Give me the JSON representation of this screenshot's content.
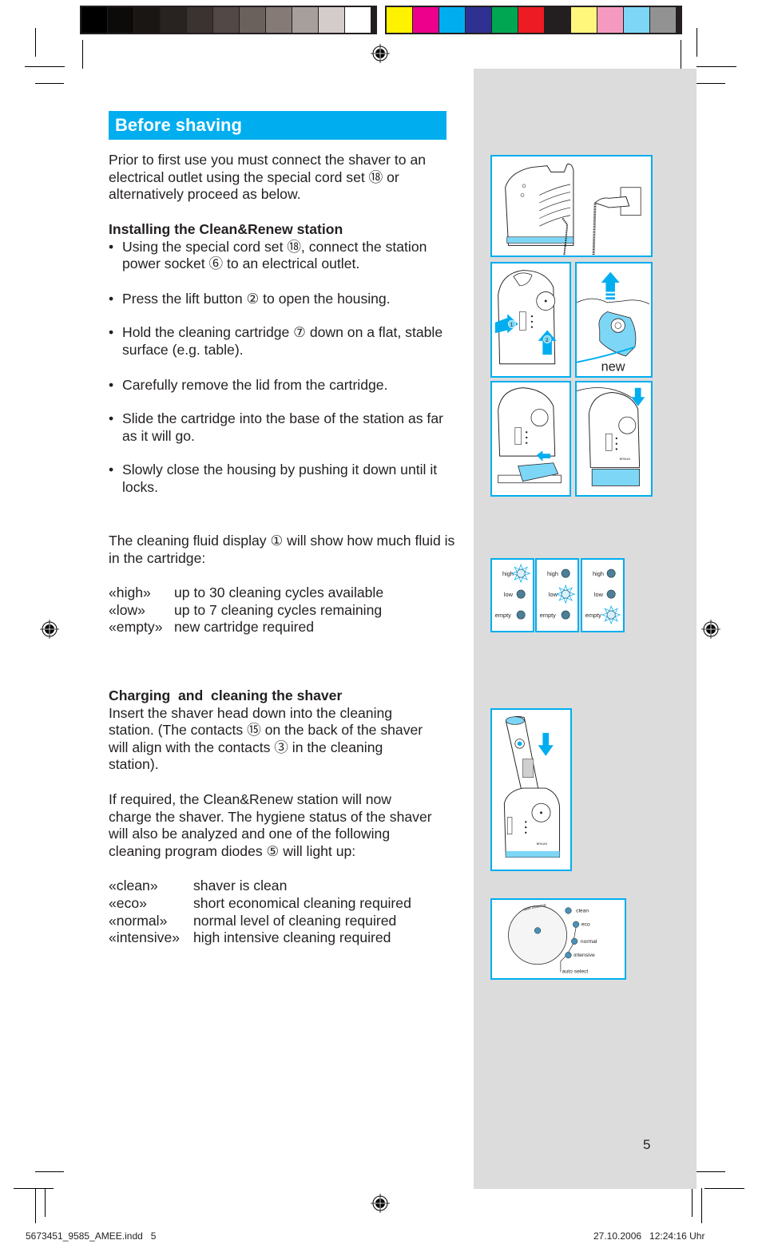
{
  "color_bar": {
    "left": [
      "#000000",
      "#0d0b0a",
      "#1a1614",
      "#282220",
      "#3b3330",
      "#524845",
      "#6a605c",
      "#857a76",
      "#a69f9c",
      "#d4cccb",
      "#ffffff"
    ],
    "right": [
      "#fff200",
      "#ec008c",
      "#00aeef",
      "#2e3192",
      "#00a651",
      "#ed1c24",
      "#231f20",
      "#fff77c",
      "#f49ac1",
      "#7dd6f6",
      "#929292"
    ]
  },
  "colors": {
    "accent": "#00aeef",
    "panel": "#dcdcdc",
    "text": "#231f20"
  },
  "title": "Before shaving",
  "intro": "Prior to first use you must connect the shaver to an electrical outlet using the special cord set ⑱ or alternatively proceed as below.",
  "install": {
    "heading": "Installing the Clean&Renew station",
    "steps": [
      "Using the special cord set ⑱, connect the station power socket ⑥ to an electrical outlet.",
      "Press the lift button ② to open the housing.",
      "Hold the cleaning cartridge ⑦ down on a flat, stable surface (e.g. table).",
      "Carefully remove the lid from the cartridge.",
      "Slide the cartridge into the base of the station as far as it will go.",
      "Slowly close the housing by pushing it down until it locks."
    ]
  },
  "fluid": {
    "intro": "The cleaning fluid display ① will show how much fluid is in the cartridge:",
    "levels": [
      {
        "term": "«high»",
        "desc": "up to 30 cleaning cycles available"
      },
      {
        "term": "«low»",
        "desc": "up to 7 cleaning cycles remaining"
      },
      {
        "term": "«empty»",
        "desc": "new cartridge required"
      }
    ]
  },
  "charging": {
    "heading": "Charging  and  cleaning the shaver",
    "p1": "Insert the shaver head down into the cleaning station. (The contacts ⑮ on the back of the shaver will align with the contacts ③ in the cleaning station).",
    "p2": "If required, the Clean&Renew station will now charge the shaver. The hygiene status of the shaver will also be analyzed and one of the following cleaning program diodes ⑤ will light up:",
    "programs": [
      {
        "term": "«clean»",
        "desc": "shaver is clean"
      },
      {
        "term": "«eco»",
        "desc": "short economical cleaning required"
      },
      {
        "term": "«normal»",
        "desc": "normal level of cleaning required"
      },
      {
        "term": "«intensive»",
        "desc": "high intensive cleaning required"
      }
    ]
  },
  "figures": {
    "fig2_label_1": "1",
    "fig2_label_2": "2",
    "fig3_label": "new",
    "display_labels": [
      "high",
      "low",
      "empty"
    ],
    "program_panel": {
      "button_label": "start cleaning",
      "diodes": [
        "clean",
        "eco",
        "normal",
        "intensive"
      ],
      "auto_label": "auto select"
    },
    "brand": "BRAUN"
  },
  "page_number": "5",
  "footer": {
    "left": "5673451_9585_AMEE.indd   5",
    "right": "27.10.2006   12:24:16 Uhr"
  }
}
